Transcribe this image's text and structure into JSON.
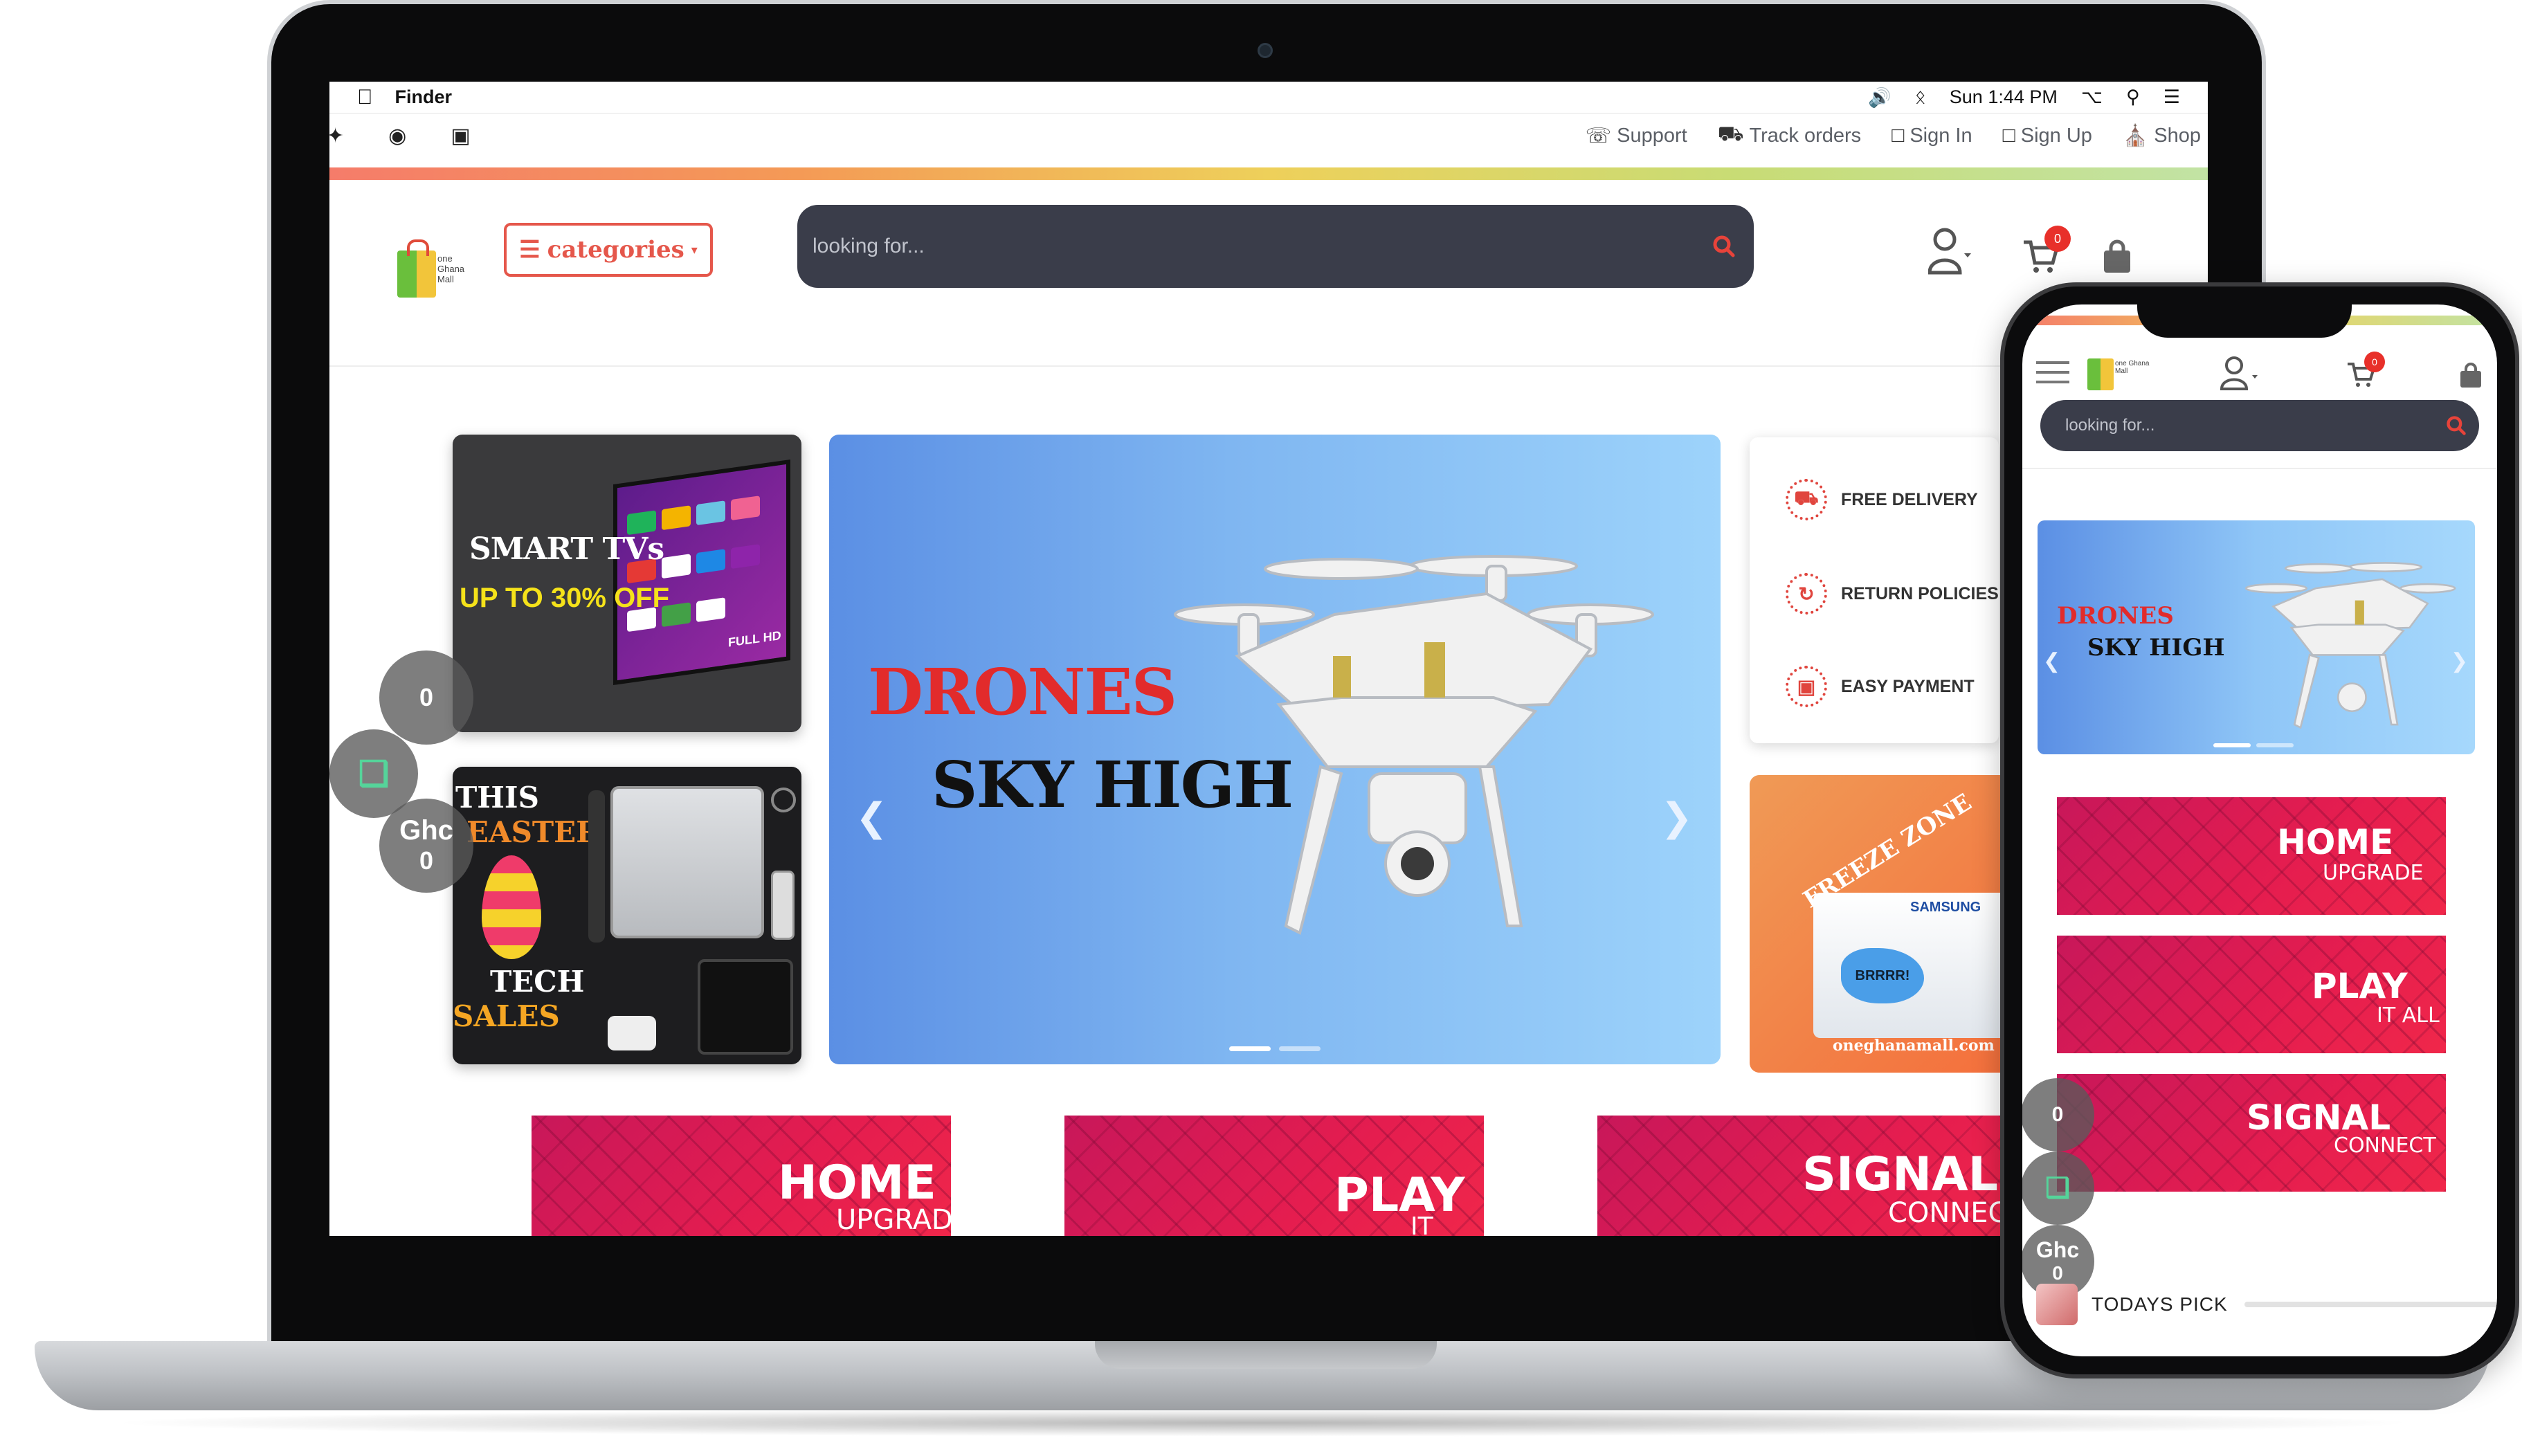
{
  "menubar": {
    "app_name": "Finder",
    "clock": "Sun 1:44 PM"
  },
  "toplinks": {
    "support": "Support",
    "track_orders": "Track orders",
    "sign_in": "Sign In",
    "sign_up": "Sign Up",
    "shop": "Shop"
  },
  "header": {
    "logo_text": "one Ghana Mall",
    "categories_label": "categories",
    "search_placeholder": "looking for...",
    "cart_count": "0"
  },
  "promos": {
    "tv_line1": "SMART TVs",
    "tv_line2": "UP TO 30% OFF",
    "tv_badge": "FULL HD",
    "easter_line1": "THIS",
    "easter_line2": "EASTER",
    "easter_line3": "TECH",
    "easter_line4": "SALES"
  },
  "hero": {
    "title_line1": "DRONES",
    "title_line2": "SKY HIGH"
  },
  "features": [
    {
      "label": "FREE DELIVERY",
      "icon": "truck-icon"
    },
    {
      "label": "RETURN POLICIES",
      "icon": "return-icon"
    },
    {
      "label": "EASY PAYMENT",
      "icon": "payment-icon"
    }
  ],
  "freeze": {
    "title": "FREEZE ZONE",
    "brand": "SAMSUNG",
    "burst": "BRRRR!",
    "url": "oneghanamall.com"
  },
  "cart_widget": {
    "items": "0",
    "currency": "Ghc",
    "amount": "0"
  },
  "categories_banners": [
    {
      "big": "HOME",
      "small": "UPGRADE"
    },
    {
      "big": "PLAY",
      "small": "IT ALL"
    },
    {
      "big": "SIGNAL",
      "small": "CONNECT"
    }
  ],
  "desktop_banner_3_small": "CONNEC",
  "phone": {
    "search_placeholder": "looking for...",
    "cart_count": "0",
    "logo_text": "one Ghana Mall",
    "todays_pick": "TODAYS PICK"
  },
  "colors": {
    "accent_red": "#e5574b",
    "search_bg": "#3a3d4a",
    "banner_red": "#e51d4f"
  }
}
